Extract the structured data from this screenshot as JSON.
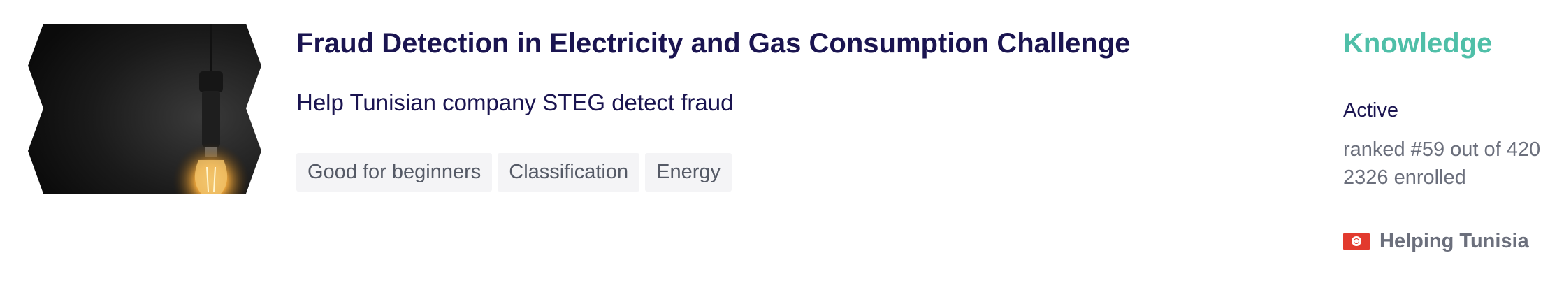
{
  "competition": {
    "title": "Fraud Detection in Electricity and Gas Consumption Challenge",
    "subtitle": "Help Tunisian company STEG detect fraud",
    "thumbnail_icon": "light-bulb-image",
    "tags": [
      "Good for beginners",
      "Classification",
      "Energy"
    ],
    "category": "Knowledge",
    "status": "Active",
    "rank_text": "ranked #59 out of 420",
    "enrolled_text": "2326 enrolled",
    "helping_text": "Helping Tunisia",
    "helping_flag_icon": "tunisia-flag-icon"
  },
  "colors": {
    "title": "#1a1450",
    "category": "#4fbfa8",
    "muted_text": "#6b6f7c",
    "tag_bg": "#f4f4f6",
    "flag_red": "#e23a2e"
  }
}
